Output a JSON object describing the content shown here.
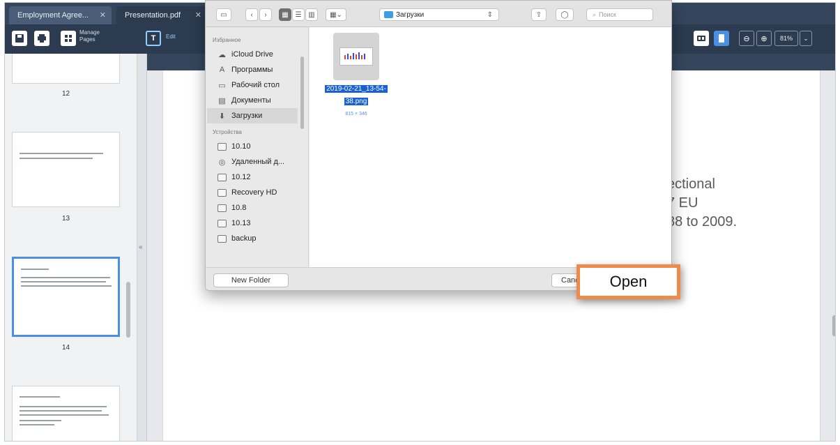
{
  "tabs": [
    {
      "label": "Employment Agree...",
      "close": "✕"
    },
    {
      "label": "Presentation.pdf",
      "close": "✕"
    }
  ],
  "toolbar": {
    "manage_pages": "Manage\nPages",
    "edit": "Edit",
    "zoom": "81%"
  },
  "sidebar": {
    "pages": [
      {
        "number": "12"
      },
      {
        "number": "13"
      },
      {
        "number": "14"
      },
      {
        "number": ""
      }
    ]
  },
  "document": {
    "visible_text": "ectional\n7 EU\n88 to 2009."
  },
  "dialog": {
    "location": "Загрузки",
    "search_placeholder": "Поиск",
    "favorites_header": "Избранное",
    "favorites": [
      "iCloud Drive",
      "Программы",
      "Рабочий стол",
      "Документы",
      "Загрузки"
    ],
    "devices_header": "Устройства",
    "devices": [
      "10.10",
      "Удаленный д...",
      "10.12",
      "Recovery HD",
      "10.8",
      "10.13",
      "backup"
    ],
    "file": {
      "name_line1": "2019-02-21_13-54-",
      "name_line2": "38.png",
      "size": "815 × 346"
    },
    "new_folder": "New Folder",
    "cancel": "Cancel"
  },
  "open_button": "Open",
  "colors": {
    "accent_orange": "#f08a4b",
    "selection_blue": "#1760d6",
    "chrome_dark": "#2c3b4f"
  }
}
